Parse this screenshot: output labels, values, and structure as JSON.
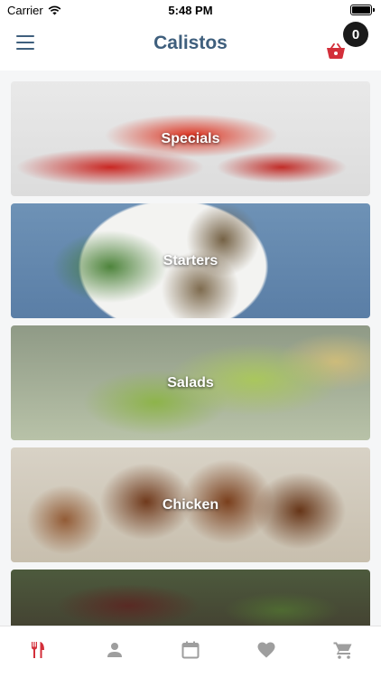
{
  "status_bar": {
    "carrier": "Carrier",
    "time": "5:48 PM"
  },
  "nav": {
    "title": "Calistos",
    "cart_count": "0",
    "menu_icon": "hamburger-menu-icon",
    "cart_icon": "basket-icon"
  },
  "categories": [
    {
      "label": "Specials"
    },
    {
      "label": "Starters"
    },
    {
      "label": "Salads"
    },
    {
      "label": "Chicken"
    },
    {
      "label": ""
    }
  ],
  "tab_bar": {
    "items": [
      {
        "icon": "fork-knife-icon",
        "active": true
      },
      {
        "icon": "person-icon",
        "active": false
      },
      {
        "icon": "calendar-icon",
        "active": false
      },
      {
        "icon": "heart-icon",
        "active": false
      },
      {
        "icon": "cart-icon",
        "active": false
      }
    ]
  },
  "colors": {
    "brand_title": "#3f5f7d",
    "accent_red": "#d32f3a",
    "icon_inactive": "#9e9e9e",
    "badge_bg": "#1a1a1a"
  }
}
